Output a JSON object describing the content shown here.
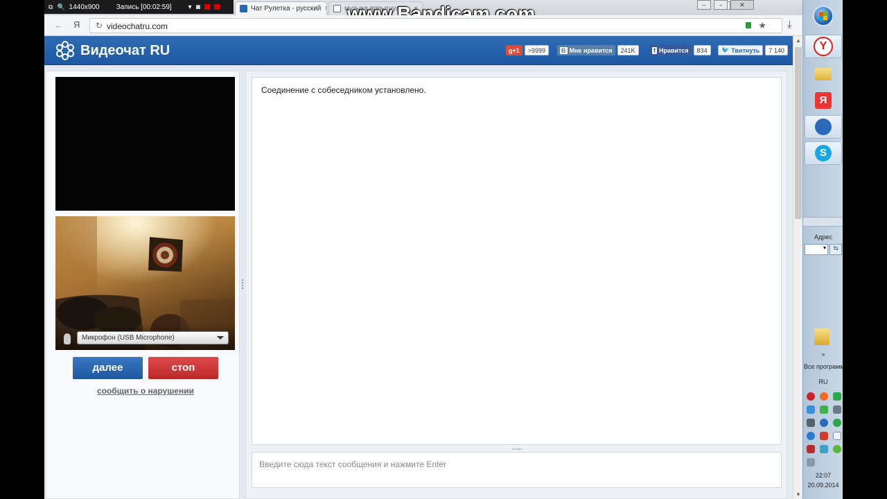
{
  "recorder": {
    "resolution": "1440x900",
    "recording": "Запись [00:02:59]"
  },
  "watermark": "www.Bandicam.com",
  "tabs": [
    {
      "title": "Чат Рулетка - русский",
      "close": "×"
    },
    {
      "title": "музыка впрыгнула",
      "close": "×"
    }
  ],
  "address_bar": {
    "url": "videochatru.com",
    "yandex_label": "Я"
  },
  "site": {
    "logo": "Видеочат RU",
    "social": {
      "gplus_label": "g+1",
      "gplus_count": ">9999",
      "vk_label": "Мне нравится",
      "vk_count": "241K",
      "fb_label": "Нравится",
      "fb_count": "834",
      "tw_label": "Твитнуть",
      "tw_count": "7 140"
    }
  },
  "left_panel": {
    "mic_select_value": "Микрофон (USB Microphone)",
    "next_button": "далее",
    "stop_button": "стоп",
    "report_link": "сообщить о нарушении"
  },
  "chat": {
    "status_message": "Соединение с собеседником установлено.",
    "input_placeholder": "Введите сюда текст сообщения и нажмите Enter"
  },
  "taskbar": {
    "address_label": "Адрес",
    "all_programs": "Все программы",
    "language": "RU",
    "time": "22:07",
    "date": "20.09.2014"
  },
  "colors": {
    "header_blue": "#2f6bb3",
    "next_blue": "#2a66b2",
    "stop_red": "#cc3535"
  }
}
